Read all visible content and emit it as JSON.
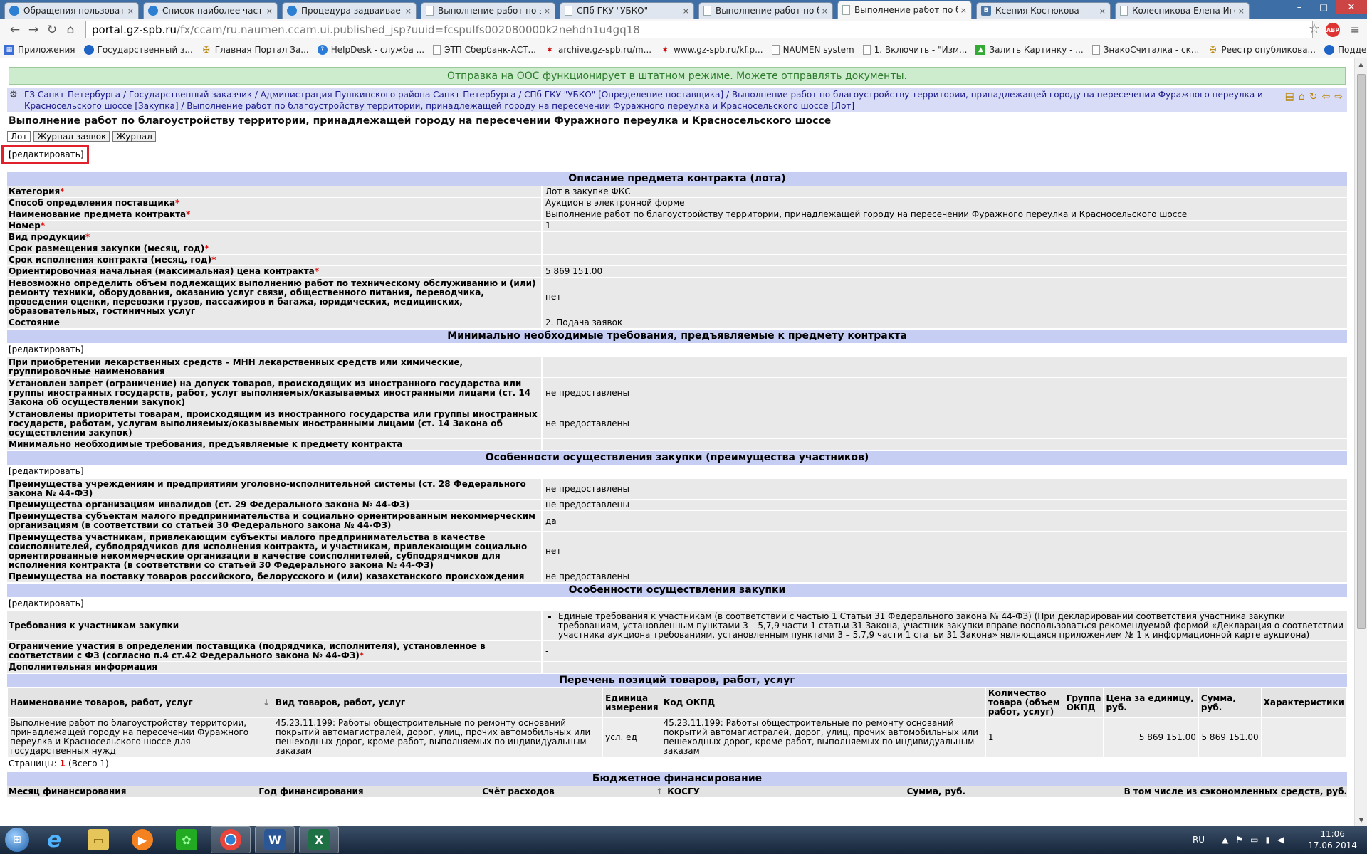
{
  "browser": {
    "tabs": [
      {
        "title": "Обращения пользовател",
        "icon": "chrome-icon",
        "active": false
      },
      {
        "title": "Список наиболее часто",
        "icon": "chrome-icon",
        "active": false
      },
      {
        "title": "Процедура задваивается",
        "icon": "chrome-icon",
        "active": false
      },
      {
        "title": "Выполнение работ по за",
        "icon": "page-icon",
        "active": false
      },
      {
        "title": "СПб ГКУ \"УБКО\"",
        "icon": "page-icon",
        "active": false
      },
      {
        "title": "Выполнение работ по бл",
        "icon": "page-icon",
        "active": false
      },
      {
        "title": "Выполнение работ по бл",
        "icon": "page-icon",
        "active": true
      },
      {
        "title": "Ксения Костюкова",
        "icon": "vk-icon",
        "active": false
      },
      {
        "title": "Колесникова Елена Игор",
        "icon": "page-icon",
        "active": false
      }
    ],
    "url_host": "portal.gz-spb.ru",
    "url_path": "/fx/ccam/ru.naumen.ccam.ui.published_jsp?uuid=fcspulfs002080000k2nehdn1u4gq18",
    "abp_label": "ABP",
    "bookmarks": [
      {
        "label": "Приложения",
        "icon": "apps-icon"
      },
      {
        "label": "Государственный з...",
        "icon": "globe-icon"
      },
      {
        "label": "Главная Портал За...",
        "icon": "crest-icon"
      },
      {
        "label": "HelpDesk - служба ...",
        "icon": "help-icon"
      },
      {
        "label": "ЭТП Сбербанк-АСТ...",
        "icon": "page-icon"
      },
      {
        "label": "archive.gz-spb.ru/m...",
        "icon": "gz-icon"
      },
      {
        "label": "www.gz-spb.ru/kf.p...",
        "icon": "gz-icon"
      },
      {
        "label": "NAUMEN system",
        "icon": "page-icon"
      },
      {
        "label": "1. Включить - \"Изм...",
        "icon": "page-icon"
      },
      {
        "label": "Залить Картинку - ...",
        "icon": "image-icon"
      },
      {
        "label": "ЗнакоСчиталка - ск...",
        "icon": "page-icon"
      },
      {
        "label": "Реестр опубликова...",
        "icon": "crest-icon"
      },
      {
        "label": "Поддержка проект...",
        "icon": "globe-icon"
      }
    ]
  },
  "page": {
    "notice": "Отправка на ООС функционирует в штатном режиме. Можете отправлять документы.",
    "breadcrumb": "ГЗ Санкт-Петербурга / Государственный заказчик / Администрация Пушкинского района Санкт-Петербурга / СПб ГКУ \"УБКО\" [Определение поставщика] / Выполнение работ по благоустройству территории, принадлежащей городу на пересечении Фуражного переулка и Красносельского шоссе [Закупка] / Выполнение работ по благоустройству территории, принадлежащей городу на пересечении Фуражного переулка и Красносельского шоссе [Лот]",
    "title": "Выполнение работ по благоустройству территории, принадлежащей городу на пересечении Фуражного переулка и Красносельского шоссе",
    "subtabs": [
      "Лот",
      "Журнал заявок",
      "Журнал"
    ],
    "edit_label": "[редактировать]",
    "sections": {
      "s1": {
        "title": "Описание предмета контракта (лота)",
        "rows": [
          {
            "k": "Категория",
            "req": "*",
            "v": "Лот в закупке ФКС"
          },
          {
            "k": "Способ определения поставщика",
            "req": "*",
            "v": "Аукцион в электронной форме"
          },
          {
            "k": "Наименование предмета контракта",
            "req": "*",
            "v": "Выполнение работ по благоустройству территории, принадлежащей городу на пересечении Фуражного переулка и Красносельского шоссе"
          },
          {
            "k": "Номер",
            "req": "*",
            "v": "1"
          },
          {
            "k": "Вид продукции",
            "req": "*",
            "v": ""
          },
          {
            "k": "Срок размещения закупки (месяц, год)",
            "req": "*",
            "v": ""
          },
          {
            "k": "Срок исполнения контракта (месяц, год)",
            "req": "*",
            "v": ""
          },
          {
            "k": "Ориентировочная начальная (максимальная) цена контракта",
            "req": "*",
            "v": "5 869 151.00"
          },
          {
            "k": "Невозможно определить объем подлежащих выполнению работ по техническому обслуживанию и (или) ремонту техники, оборудования, оказанию услуг связи, общественного питания, переводчика, проведения оценки, перевозки грузов, пассажиров и багажа, юридических, медицинских, образовательных, гостиничных услуг",
            "req": "",
            "v": "нет"
          },
          {
            "k": "Состояние",
            "req": "",
            "v": "2. Подача заявок"
          }
        ]
      },
      "s2": {
        "title": "Минимально необходимые требования, предъявляемые к предмету контракта",
        "rows": [
          {
            "k": "При приобретении лекарственных средств – МНН лекарственных средств или химические, группировочные наименования",
            "req": "",
            "v": ""
          },
          {
            "k": "Установлен запрет (ограничение) на допуск товаров, происходящих из иностранного государства или группы иностранных государств, работ, услуг выполняемых/оказываемых иностранными лицами (ст. 14 Закона об осуществлении закупок)",
            "req": "",
            "v": "не предоставлены"
          },
          {
            "k": "Установлены приоритеты товарам, происходящим из иностранного государства или группы иностранных государств, работам, услугам выполняемых/оказываемых иностранными лицами (ст. 14 Закона об осуществлении закупок)",
            "req": "",
            "v": "не предоставлены"
          },
          {
            "k": "Минимально необходимые требования, предъявляемые к предмету контракта",
            "req": "",
            "v": ""
          }
        ]
      },
      "s3": {
        "title": "Особенности осуществления закупки (преимущества участников)",
        "rows": [
          {
            "k": "Преимущества учреждениям и предприятиям уголовно-исполнительной системы (ст. 28 Федерального закона № 44-ФЗ)",
            "req": "",
            "v": "не предоставлены"
          },
          {
            "k": "Преимущества организациям инвалидов (ст. 29 Федерального закона № 44-ФЗ)",
            "req": "",
            "v": "не предоставлены"
          },
          {
            "k": "Преимущества субъектам малого предпринимательства и социально ориентированным некоммерческим организациям (в соответствии со статьей 30 Федерального закона № 44-ФЗ)",
            "req": "",
            "v": "да"
          },
          {
            "k": "Преимущества участникам, привлекающим субъекты малого предпринимательства в качестве соисполнителей, субподрядчиков для исполнения контракта, и участникам, привлекающим социально ориентированные некоммерческие организации в качестве соисполнителей, субподрядчиков для исполнения контракта (в соответствии со статьей 30 Федерального закона № 44-ФЗ)",
            "req": "",
            "v": "нет"
          },
          {
            "k": "Преимущества на поставку товаров российского, белорусского и (или) казахстанского происхождения",
            "req": "",
            "v": "не предоставлены"
          }
        ]
      },
      "s4": {
        "title": "Особенности осуществления закупки",
        "req_label": "Требования к участникам закупки",
        "req_value": "Единые требования к участникам (в соответствии с частью 1 Статьи 31 Федерального закона № 44-ФЗ) (При декларировании соответствия участника закупки требованиям, установленным пунктами 3 – 5,7,9 части 1 статьи 31 Закона, участник закупки вправе воспользоваться рекомендуемой формой «Декларация о соответствии участника аукциона требованиям, установленным пунктами 3 – 5,7,9 части 1 статьи 31 Закона» являющаяся приложением № 1 к информационной карте аукциона)",
        "rows": [
          {
            "k": "Ограничение участия в определении поставщика (подрядчика, исполнителя), установленное в соответствии с ФЗ (согласно п.4 ст.42 Федерального закона № 44-ФЗ)",
            "req": "*",
            "v": "-"
          },
          {
            "k": "Дополнительная информация",
            "req": "",
            "v": ""
          }
        ]
      },
      "s5": {
        "title": "Перечень позиций товаров, работ, услуг",
        "headers": [
          "Наименование товаров, работ, услуг",
          "Вид товаров, работ, услуг",
          "Единица измерения",
          "Код ОКПД",
          "Количество товара (объем работ, услуг)",
          "Группа ОКПД",
          "Цена за единицу, руб.",
          "Сумма, руб.",
          "Характеристики"
        ],
        "row": [
          "Выполнение работ по благоустройству территории, принадлежащей городу на пересечении Фуражного переулка и Красносельского шоссе для государственных нужд",
          "45.23.11.199: Работы общестроительные по ремонту оснований покрытий автомагистралей, дорог, улиц, прочих автомобильных или пешеходных дорог, кроме работ, выполняемых по индивидуальным заказам",
          "усл. ед",
          "45.23.11.199: Работы общестроительные по ремонту оснований покрытий автомагистралей, дорог, улиц, прочих автомобильных или пешеходных дорог, кроме работ, выполняемых по индивидуальным заказам",
          "1",
          "",
          "5 869 151.00",
          "5 869 151.00",
          ""
        ],
        "pages_label": "Страницы:",
        "page_current": "1",
        "pages_total": "(Всего 1)"
      },
      "s6": {
        "title": "Бюджетное финансирование",
        "headers": [
          "Месяц финансирования",
          "Год финансирования",
          "Счёт расходов",
          "КОСГУ",
          "Сумма, руб.",
          "В том числе из сэкономленных средств, руб."
        ]
      }
    }
  },
  "taskbar": {
    "apps": [
      {
        "name": "ie-icon",
        "label": "e"
      },
      {
        "name": "explorer-icon",
        "label": "▭"
      },
      {
        "name": "media-player-icon",
        "label": "▶"
      },
      {
        "name": "icq-icon",
        "label": "✿"
      },
      {
        "name": "chrome-icon",
        "label": "◉"
      },
      {
        "name": "word-icon",
        "label": "W"
      },
      {
        "name": "excel-icon",
        "label": "X"
      }
    ],
    "lang": "RU",
    "time": "11:06",
    "date": "17.06.2014"
  }
}
